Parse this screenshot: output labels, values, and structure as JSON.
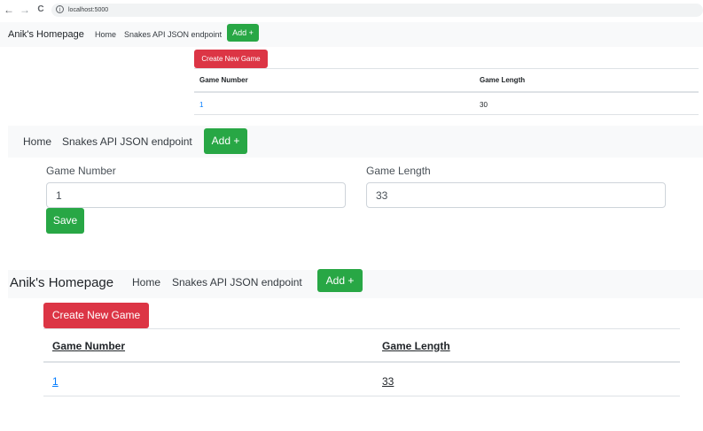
{
  "browser": {
    "back_icon": "←",
    "forward_icon": "→",
    "reload_icon": "C",
    "info_icon": "i",
    "url": "localhost:5000"
  },
  "section1": {
    "brand": "Anik's Homepage",
    "nav_links": [
      "Home",
      "Snakes API JSON endpoint"
    ],
    "add_button": "Add +",
    "create_button": "Create New Game",
    "table": {
      "headers": [
        "Game Number",
        "Game Length"
      ],
      "rows": [
        {
          "number": "1",
          "length": "30"
        }
      ]
    }
  },
  "form_section": {
    "nav_links": [
      "Home",
      "Snakes API JSON endpoint"
    ],
    "add_button": "Add +",
    "game_number_label": "Game Number",
    "game_number_value": "1",
    "game_length_label": "Game Length",
    "game_length_value": "33",
    "save_button": "Save"
  },
  "section3": {
    "brand": "Anik's Homepage",
    "nav_links": [
      "Home",
      "Snakes API JSON endpoint"
    ],
    "add_button": "Add +",
    "create_button": "Create New Game",
    "table": {
      "headers": [
        "Game Number",
        "Game Length"
      ],
      "rows": [
        {
          "number": "1",
          "length": "33"
        }
      ]
    }
  },
  "colors": {
    "success": "#28a745",
    "danger": "#dc3545",
    "link": "#007bff",
    "navbar_bg": "#f8f9fa",
    "border": "#dee2e6"
  }
}
